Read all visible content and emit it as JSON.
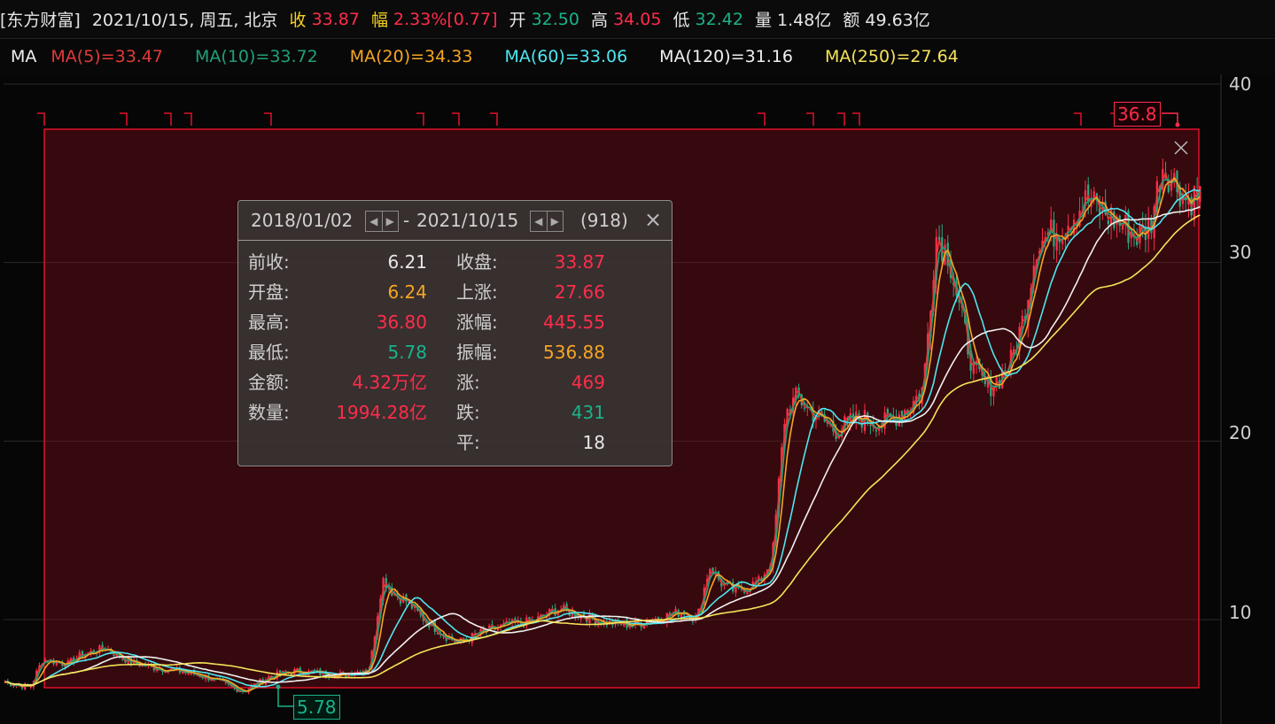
{
  "header": {
    "name": "[东方财富]",
    "date": "2021/10/15, 周五, 北京",
    "close_label": "收",
    "close_value": "33.87",
    "change_label": "幅",
    "change_pct": "2.33%",
    "change_abs": "[0.77]",
    "open_label": "开",
    "open_value": "32.50",
    "high_label": "高",
    "high_value": "34.05",
    "low_label": "低",
    "low_value": "32.42",
    "volume_label": "量",
    "volume_value": "1.48亿",
    "amount_label": "额",
    "amount_value": "49.63亿"
  },
  "ma_bar": {
    "label": "MA",
    "items": [
      {
        "text": "MA(5)=33.47",
        "color": "#e03a3a"
      },
      {
        "text": "MA(10)=33.72",
        "color": "#1fa07a"
      },
      {
        "text": "MA(20)=34.33",
        "color": "#f5a623"
      },
      {
        "text": "MA(60)=33.06",
        "color": "#4ee6f0"
      },
      {
        "text": "MA(120)=31.16",
        "color": "#f0f0f0"
      },
      {
        "text": "MA(250)=27.64",
        "color": "#f5e35a"
      }
    ]
  },
  "chart_data": {
    "type": "candlestick",
    "title": "",
    "y_ticks": [
      "40",
      "30",
      "20",
      "10"
    ],
    "ylim": [
      5,
      42
    ],
    "x_range": [
      "2018/01/02",
      "2021/10/15"
    ],
    "max_marker": "36.8",
    "min_marker": "5.78",
    "series": [
      {
        "name": "MA(5)",
        "color": "#e03a3a"
      },
      {
        "name": "MA(10)",
        "color": "#1fa07a"
      },
      {
        "name": "MA(20)",
        "color": "#f5a623"
      },
      {
        "name": "MA(60)",
        "color": "#4ee6f0"
      },
      {
        "name": "MA(120)",
        "color": "#f0f0f0"
      },
      {
        "name": "MA(250)",
        "color": "#f5e35a"
      }
    ],
    "price_path": [
      [
        0,
        6.5
      ],
      [
        2,
        6.2
      ],
      [
        3,
        7.8
      ],
      [
        5,
        7.5
      ],
      [
        6,
        8.0
      ],
      [
        8,
        8.4
      ],
      [
        10,
        7.6
      ],
      [
        12,
        7.3
      ],
      [
        14,
        7.1
      ],
      [
        16,
        6.8
      ],
      [
        18,
        6.2
      ],
      [
        19,
        6.0
      ],
      [
        21,
        6.8
      ],
      [
        23,
        7.1
      ],
      [
        25,
        7.0
      ],
      [
        27,
        6.9
      ],
      [
        29,
        7.3
      ],
      [
        30,
        12.3
      ],
      [
        31,
        11.4
      ],
      [
        32,
        11.0
      ],
      [
        33,
        10.2
      ],
      [
        35,
        9.1
      ],
      [
        36,
        8.7
      ],
      [
        38,
        9.3
      ],
      [
        40,
        9.7
      ],
      [
        42,
        9.9
      ],
      [
        44,
        10.6
      ],
      [
        46,
        10.2
      ],
      [
        48,
        9.8
      ],
      [
        50,
        9.7
      ],
      [
        52,
        10.1
      ],
      [
        54,
        10.5
      ],
      [
        55,
        10.0
      ],
      [
        56,
        13.0
      ],
      [
        57,
        12.0
      ],
      [
        58,
        11.6
      ],
      [
        60,
        12.1
      ],
      [
        61,
        13.5
      ],
      [
        62,
        21.5
      ],
      [
        63,
        22.5
      ],
      [
        64,
        21.7
      ],
      [
        66,
        20.6
      ],
      [
        68,
        21.3
      ],
      [
        70,
        21.0
      ],
      [
        72,
        22.0
      ],
      [
        73,
        23.0
      ],
      [
        74,
        31.5
      ],
      [
        75,
        30.5
      ],
      [
        76,
        27.0
      ],
      [
        77,
        24.0
      ],
      [
        78,
        23.0
      ],
      [
        79,
        23.5
      ],
      [
        80,
        24.5
      ],
      [
        81,
        27.0
      ],
      [
        82,
        31.0
      ],
      [
        84,
        32.0
      ],
      [
        86,
        33.5
      ],
      [
        88,
        32.5
      ],
      [
        90,
        31.5
      ],
      [
        91,
        32.0
      ],
      [
        92,
        35.5
      ],
      [
        93,
        34.5
      ],
      [
        94,
        33.5
      ],
      [
        95,
        33.87
      ]
    ]
  },
  "popup": {
    "start_date": "2018/01/02",
    "sep": "-",
    "end_date": "2021/10/15",
    "count": "(918)",
    "close_icon": "×",
    "rows": [
      {
        "l1": "前收:",
        "v1": "6.21",
        "c1": "#e6e6e6",
        "l2": "收盘:",
        "v2": "33.87",
        "c2": "#ff2d4a"
      },
      {
        "l1": "开盘:",
        "v1": "6.24",
        "c1": "#f5a623",
        "l2": "上涨:",
        "v2": "27.66",
        "c2": "#ff2d4a"
      },
      {
        "l1": "最高:",
        "v1": "36.80",
        "c1": "#ff2d4a",
        "l2": "涨幅:",
        "v2": "445.55",
        "c2": "#ff2d4a"
      },
      {
        "l1": "最低:",
        "v1": "5.78",
        "c1": "#19b38a",
        "l2": "振幅:",
        "v2": "536.88",
        "c2": "#f5a623"
      },
      {
        "l1": "金额:",
        "v1": "4.32万亿",
        "c1": "#ff2d4a",
        "l2": "涨:",
        "v2": "469",
        "c2": "#ff2d4a"
      },
      {
        "l1": "数量:",
        "v1": "1994.28亿",
        "c1": "#ff2d4a",
        "l2": "跌:",
        "v2": "431",
        "c2": "#19b38a"
      },
      {
        "l1": "",
        "v1": "",
        "c1": "#e6e6e6",
        "l2": "平:",
        "v2": "18",
        "c2": "#e6e6e6"
      }
    ]
  }
}
